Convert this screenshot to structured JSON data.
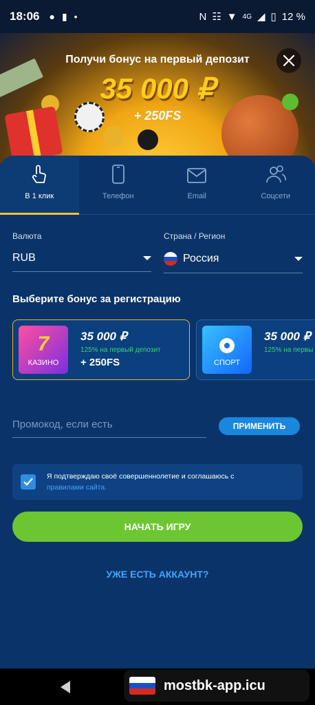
{
  "status_bar": {
    "time": "18:06",
    "network": "4G",
    "battery": "12 %"
  },
  "banner": {
    "headline": "Получи бонус на первый депозит",
    "amount": "35 000 ₽",
    "free_spins": "+ 250FS"
  },
  "tabs": [
    {
      "label": "В 1 клик",
      "icon": "hand-pointer-icon",
      "active": true
    },
    {
      "label": "Телефон",
      "icon": "phone-icon",
      "active": false
    },
    {
      "label": "Email",
      "icon": "mail-icon",
      "active": false
    },
    {
      "label": "Соцсети",
      "icon": "users-icon",
      "active": false
    }
  ],
  "form": {
    "currency": {
      "label": "Валюта",
      "value": "RUB"
    },
    "country": {
      "label": "Страна / Регион",
      "value": "Россия"
    },
    "bonus_title": "Выберите бонус за регистрацию",
    "bonuses": [
      {
        "image_label": "КАЗИНО",
        "image_glyph": "7",
        "amount": "35 000 ₽",
        "description": "125% на первый депозит",
        "extra": "+ 250FS",
        "selected": true
      },
      {
        "image_label": "СПОРТ",
        "amount": "35 000 ₽",
        "description": "125% на первы",
        "selected": false
      }
    ],
    "promo_placeholder": "Промокод, если есть",
    "apply_label": "ПРИМЕНИТЬ",
    "consent_text": "Я подтверждаю своё совершеннолетие и соглашаюсь с",
    "consent_link": "правилами сайта.",
    "start_label": "НАЧАТЬ ИГРУ",
    "account_link": "УЖЕ ЕСТЬ АККАУНТ?"
  },
  "watermark": {
    "text": "mostbk-app.icu"
  },
  "colors": {
    "background": "#0a3469",
    "accent_gold": "#f2c230",
    "button_blue": "#1a86dd",
    "button_green": "#6cc631",
    "link_blue": "#45a4ff"
  }
}
